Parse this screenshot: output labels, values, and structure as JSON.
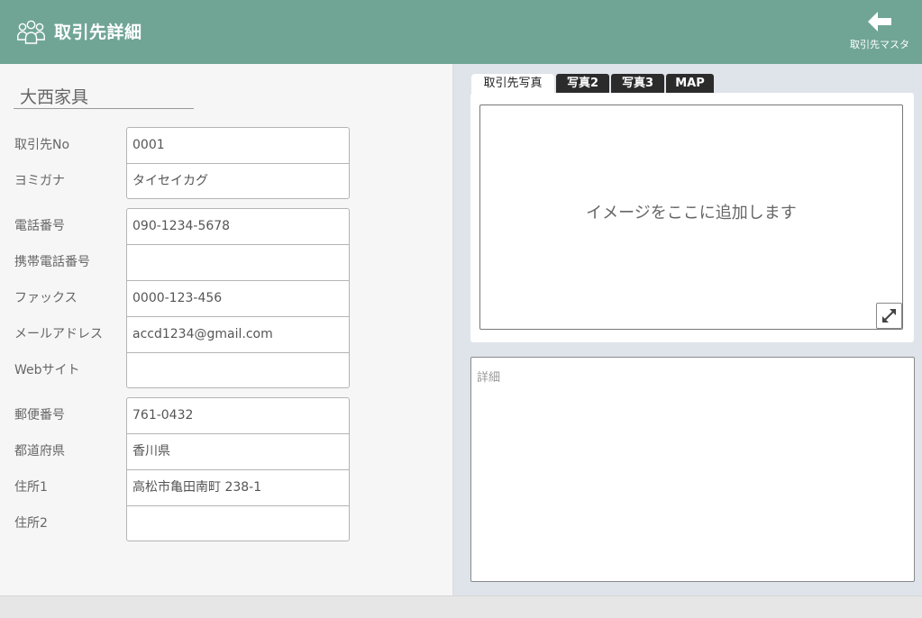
{
  "header": {
    "title": "取引先詳細",
    "back_label": "取引先マスタ"
  },
  "company_name": "大西家具",
  "groups": [
    [
      {
        "label": "取引先No",
        "value": "0001"
      },
      {
        "label": "ヨミガナ",
        "value": "タイセイカグ"
      }
    ],
    [
      {
        "label": "電話番号",
        "value": "090-1234-5678"
      },
      {
        "label": "携帯電話番号",
        "value": ""
      },
      {
        "label": "ファックス",
        "value": "0000-123-456"
      },
      {
        "label": "メールアドレス",
        "value": "accd1234@gmail.com"
      },
      {
        "label": "Webサイト",
        "value": ""
      }
    ],
    [
      {
        "label": "郵便番号",
        "value": "761-0432"
      },
      {
        "label": "都道府県",
        "value": "香川県"
      },
      {
        "label": "住所1",
        "value": "高松市亀田南町 238-1"
      },
      {
        "label": "住所2",
        "value": ""
      }
    ]
  ],
  "tabs": [
    "取引先写真",
    "写真2",
    "写真3",
    "MAP"
  ],
  "active_tab": "取引先写真",
  "photo_placeholder": "イメージをここに追加します",
  "details_placeholder": "詳細",
  "colors": {
    "header": "#70a595",
    "left_panel": "#f6f6f6",
    "right_panel": "#dfe3ea",
    "tab_dark": "#2b2b2b"
  }
}
